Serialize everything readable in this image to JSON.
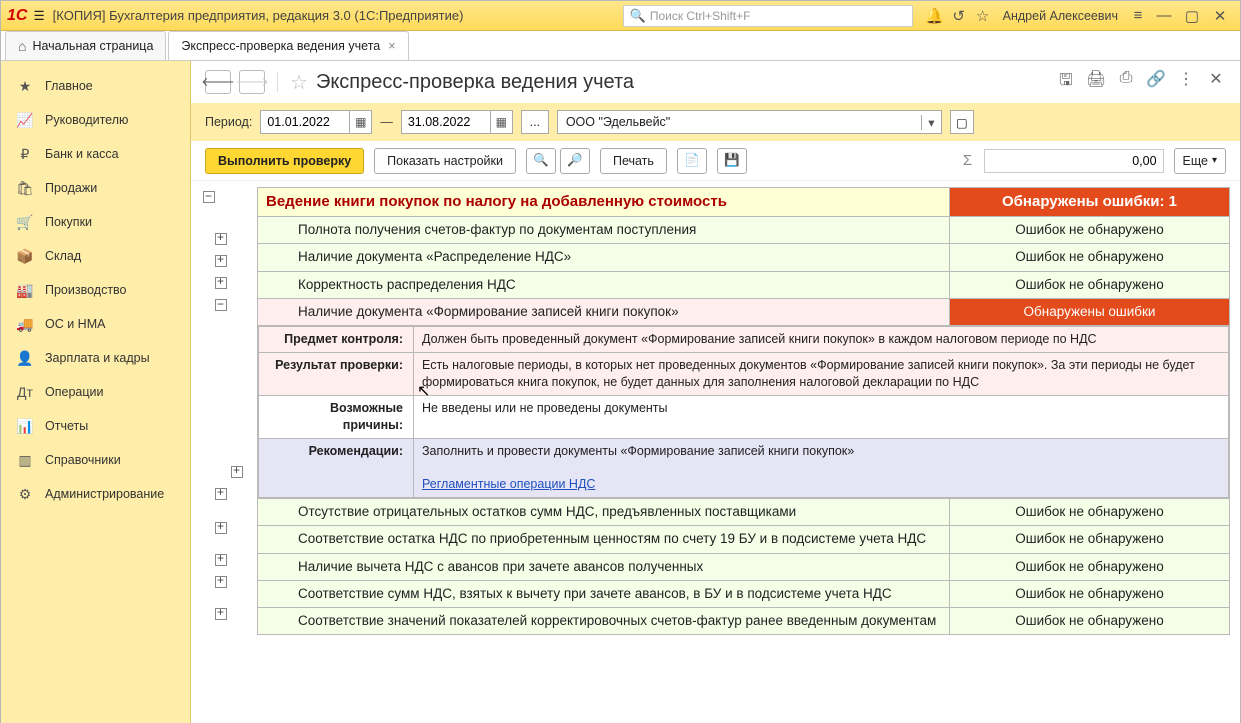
{
  "titlebar": {
    "title": "[КОПИЯ] Бухгалтерия предприятия, редакция 3.0  (1С:Предприятие)",
    "search_placeholder": "Поиск Ctrl+Shift+F",
    "username": "Андрей Алексеевич"
  },
  "tabs": {
    "home": "Начальная страница",
    "active": "Экспресс-проверка ведения учета"
  },
  "sidebar": {
    "items": [
      "Главное",
      "Руководителю",
      "Банк и касса",
      "Продажи",
      "Покупки",
      "Склад",
      "Производство",
      "ОС и НМА",
      "Зарплата и кадры",
      "Операции",
      "Отчеты",
      "Справочники",
      "Администрирование"
    ]
  },
  "page": {
    "title": "Экспресс-проверка ведения учета"
  },
  "period": {
    "label": "Период:",
    "from": "01.01.2022",
    "to": "31.08.2022",
    "org": "ООО \"Эдельвейс\"",
    "ellipsis": "..."
  },
  "toolbar": {
    "run": "Выполнить проверку",
    "show_settings": "Показать настройки",
    "print": "Печать",
    "sum_value": "0,00",
    "more": "Еще"
  },
  "report": {
    "section": {
      "title": "Ведение книги покупок по налогу на добавленную стоимость",
      "status": "Обнаружены ошибки: 1"
    },
    "rows": [
      {
        "name": "Полнота получения счетов-фактур по документам поступления",
        "status": "Ошибок не обнаружено",
        "kind": "ok"
      },
      {
        "name": "Наличие документа «Распределение НДС»",
        "status": "Ошибок не обнаружено",
        "kind": "ok"
      },
      {
        "name": "Корректность распределения НДС",
        "status": "Ошибок не обнаружено",
        "kind": "ok"
      },
      {
        "name": "Наличие документа «Формирование записей книги покупок»",
        "status": "Обнаружены ошибки",
        "kind": "err"
      }
    ],
    "details": {
      "subject_label": "Предмет контроля:",
      "subject_text": "Должен быть проведенный документ «Формирование записей книги покупок» в каждом налоговом периоде по НДС",
      "result_label": "Результат проверки:",
      "result_text": "Есть налоговые периоды, в которых нет проведенных документов «Формирование записей книги покупок». За эти периоды не будет формироваться книга покупок, не будет данных для заполнения налоговой декларации по НДС",
      "reasons_label": "Возможные причины:",
      "reasons_text": "Не введены или не проведены документы",
      "recs_label": "Рекомендации:",
      "recs_text": "Заполнить и провести документы «Формирование записей книги покупок»",
      "recs_link": "Регламентные операции НДС"
    },
    "tail": [
      {
        "name": "Отсутствие отрицательных остатков сумм НДС, предъявленных поставщиками",
        "status": "Ошибок не обнаружено"
      },
      {
        "name": "Соответствие остатка НДС по приобретенным ценностям по счету 19 БУ и в подсистеме учета НДС",
        "status": "Ошибок не обнаружено"
      },
      {
        "name": "Наличие вычета НДС с авансов при зачете авансов полученных",
        "status": "Ошибок не обнаружено"
      },
      {
        "name": "Соответствие сумм НДС, взятых к вычету при зачете авансов, в БУ и в подсистеме учета НДС",
        "status": "Ошибок не обнаружено"
      },
      {
        "name": "Соответствие значений показателей корректировочных счетов-фактур ранее введенным документам",
        "status": "Ошибок не обнаружено"
      }
    ]
  }
}
